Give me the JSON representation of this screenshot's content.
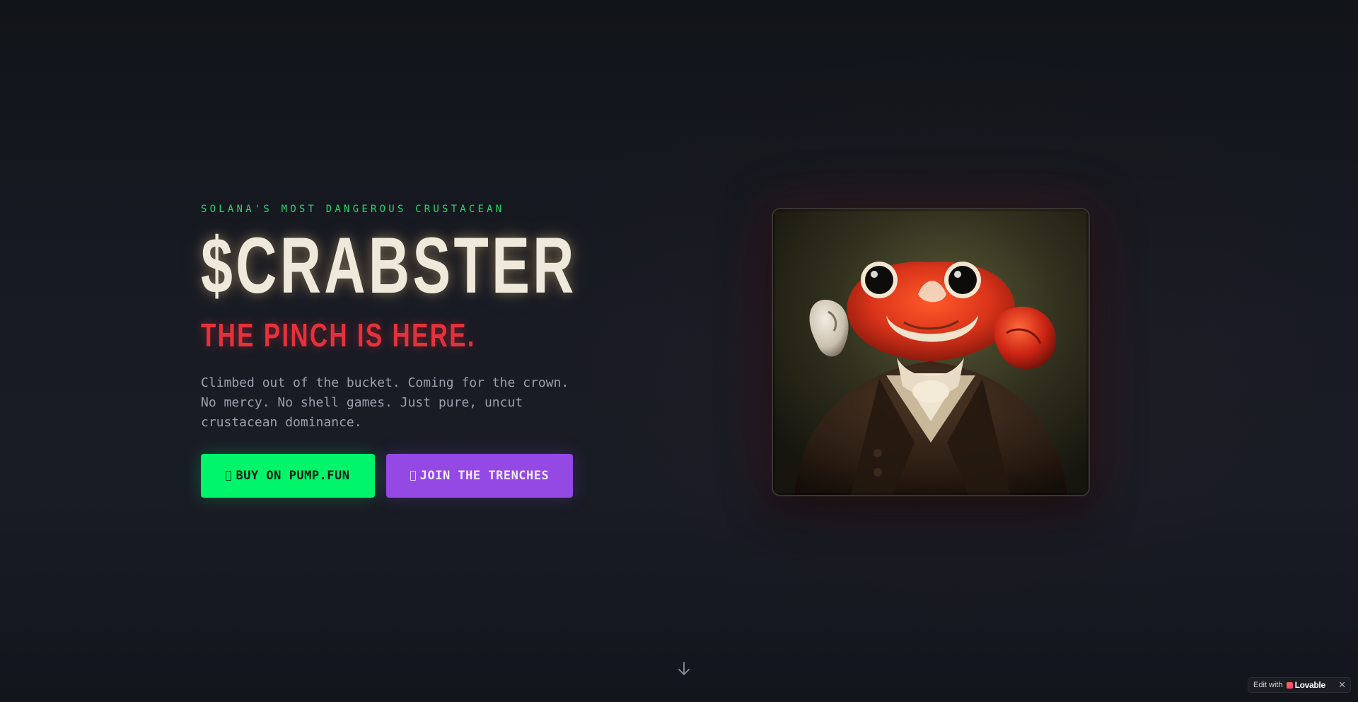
{
  "hero": {
    "eyebrow": "SOLANA'S MOST DANGEROUS CRUSTACEAN",
    "title": "$CRABSTER",
    "subtitle": "THE PINCH IS HERE.",
    "description_lines": [
      "Climbed out of the bucket. Coming for the crown.",
      "No mercy. No shell games. Just pure, uncut",
      "crustacean dominance."
    ],
    "buy_button": {
      "label": "BUY ON PUMP.FUN",
      "icon": "external-glyph-icon",
      "color": "#00f56a"
    },
    "join_button": {
      "label": "JOIN THE TRENCHES",
      "icon": "external-glyph-icon",
      "color": "#9448e4"
    },
    "image": {
      "subject": "crab-frog-portrait",
      "alt": ""
    }
  },
  "scroll_indicator": {
    "icon": "arrow-down-icon"
  },
  "badge": {
    "edit_label": "Edit with",
    "brand_label": "Lovable",
    "close_label": "✕"
  },
  "colors": {
    "accent_green": "#2bd46c",
    "accent_red": "#e5313b",
    "title_cream": "#efe9dc",
    "background": "#181b24"
  }
}
